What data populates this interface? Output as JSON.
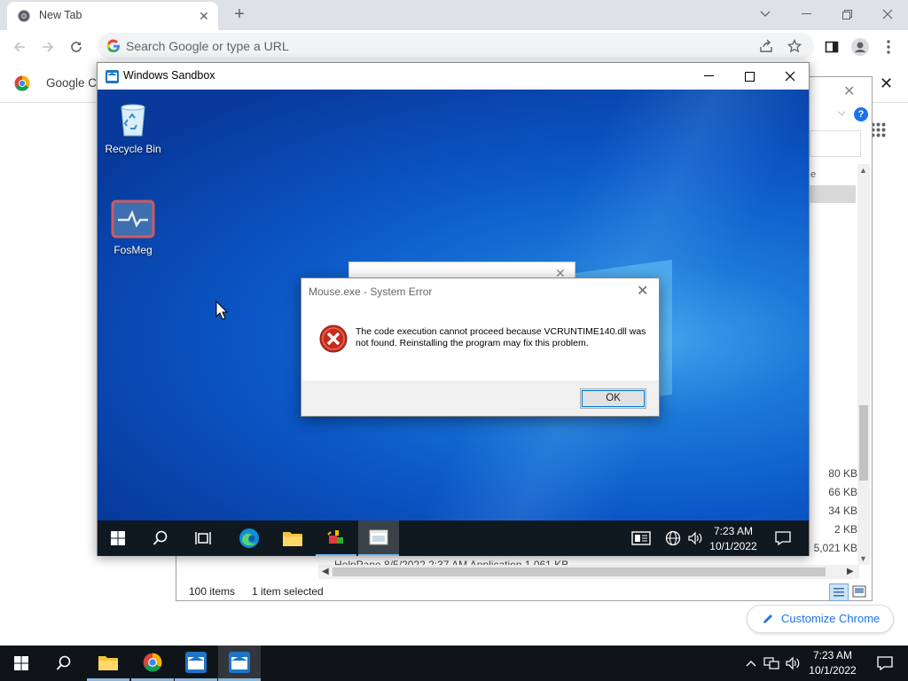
{
  "chrome": {
    "tab_title": "New Tab",
    "omnibox_placeholder": "Search Google or type a URL",
    "bookmark_label": "Google Ch",
    "customize_label": "Customize Chrome"
  },
  "explorer": {
    "status_items": "100 items",
    "status_selected": "1 item selected",
    "sizes": [
      "80 KB",
      "66 KB",
      "34 KB",
      "2 KB",
      "5,021 KB"
    ],
    "partial_row": "HelpPane        8/5/2022 2:37 AM        Application        1,061 KB",
    "column_fragment": "e"
  },
  "sandbox": {
    "title": "Windows Sandbox",
    "desktop_icons": [
      "Recycle Bin",
      "FosMeg"
    ],
    "taskbar_time": "7:23 AM",
    "taskbar_date": "10/1/2022"
  },
  "dialog": {
    "title": "Mouse.exe - System Error",
    "message": "The code execution cannot proceed because VCRUNTIME140.dll was not found. Reinstalling the program may fix this problem.",
    "ok_label": "OK"
  },
  "taskbar": {
    "time": "7:23 AM",
    "date": "10/1/2022"
  },
  "colors": {
    "chrome_blue": "#1a73e8",
    "error_red": "#c42b1c",
    "taskbar": "#0f1419"
  }
}
